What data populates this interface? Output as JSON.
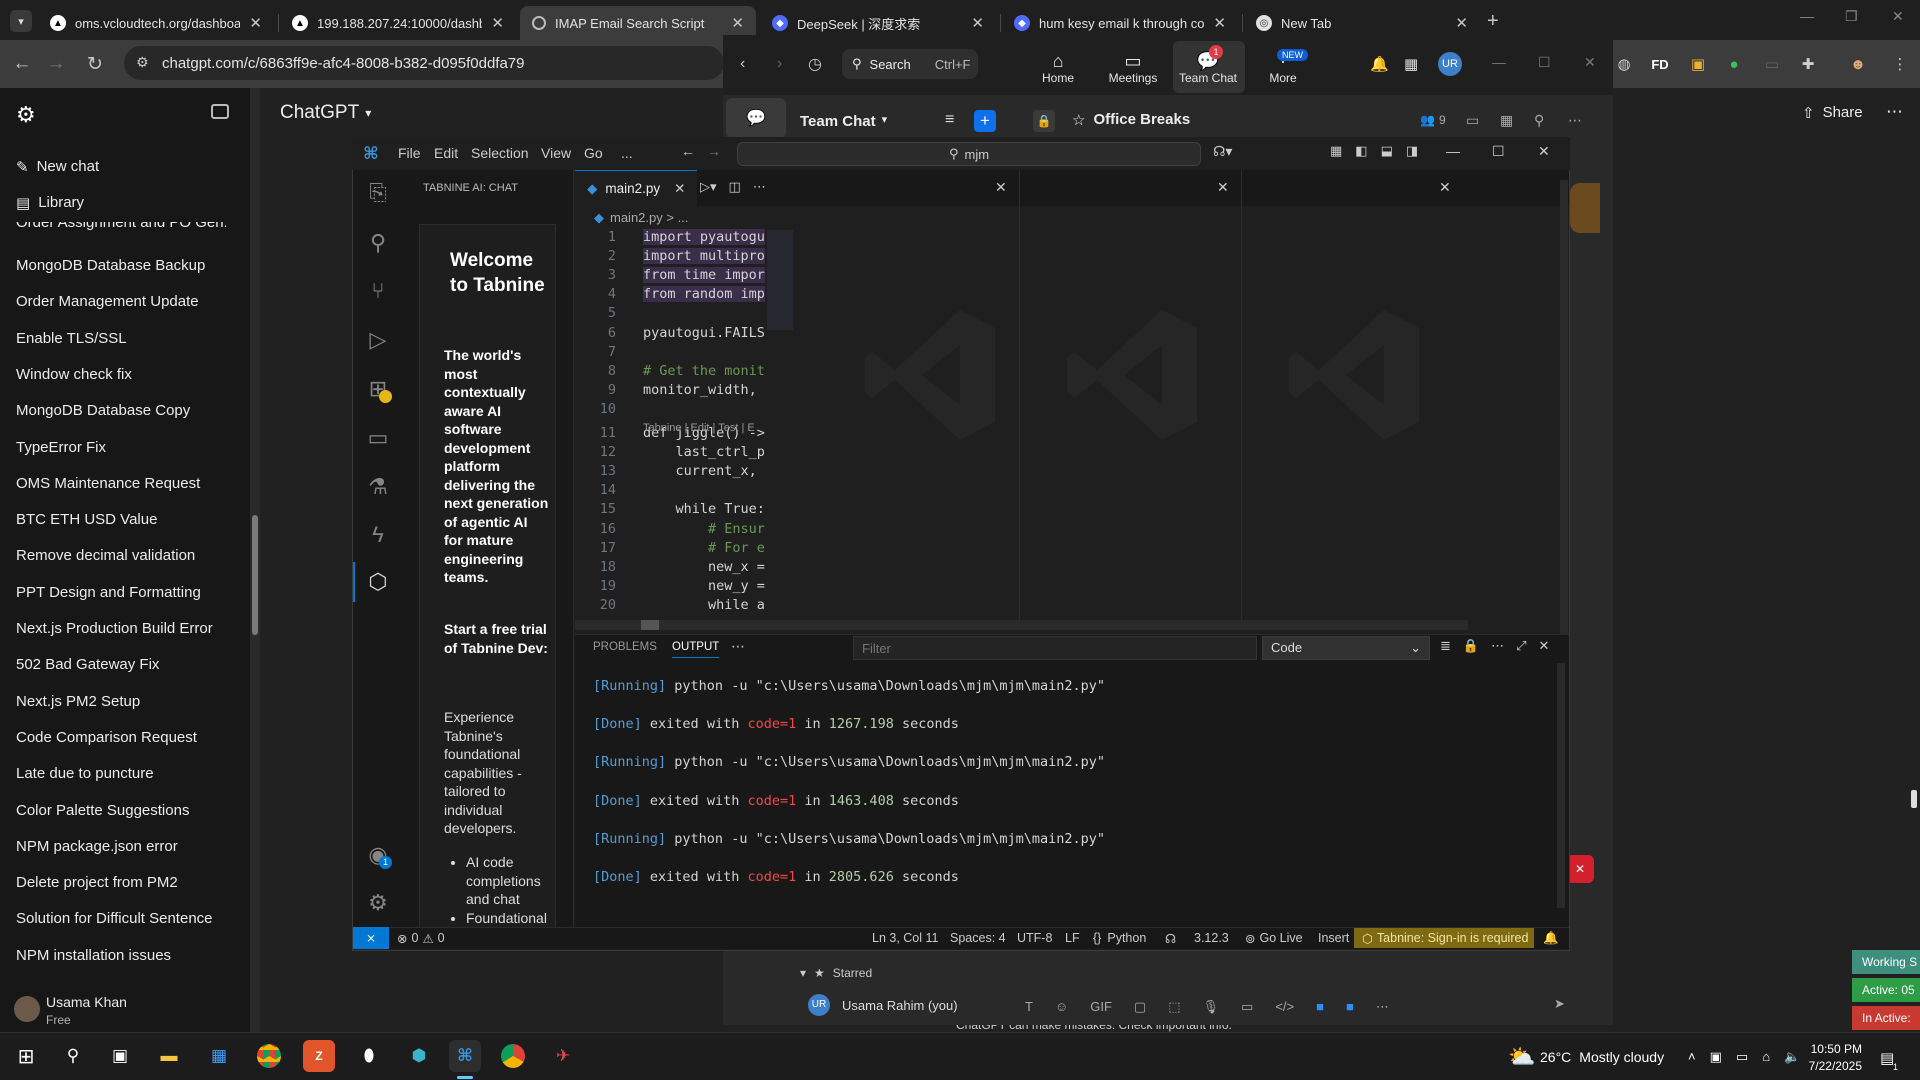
{
  "browser": {
    "tabs": [
      {
        "label": "oms.vcloudtech.org/dashboard",
        "active": false
      },
      {
        "label": "199.188.207.24:10000/dashboa",
        "active": false
      },
      {
        "label": "IMAP Email Search Script",
        "active": true
      },
      {
        "label": "DeepSeek | 深度求索",
        "active": false
      },
      {
        "label": "hum kesy email k through code",
        "active": false
      },
      {
        "label": "New Tab",
        "active": false
      }
    ],
    "url": "chatgpt.com/c/6863ff9e-afc4-8008-b382-d095f0ddfa79"
  },
  "chatgpt": {
    "title": "ChatGPT",
    "share_label": "Share",
    "new_chat": "New chat",
    "library": "Library",
    "partial_item": "Order Assignment and PO Gen...",
    "history": [
      "MongoDB Database Backup",
      "Order Management Update",
      "Enable TLS/SSL",
      "Window check fix",
      "MongoDB Database Copy",
      "TypeError Fix",
      "OMS Maintenance Request",
      "BTC ETH USD Value",
      "Remove decimal validation",
      "PPT Design and Formatting",
      "Next.js Production Build Error",
      "502 Bad Gateway Fix",
      "Next.js PM2 Setup",
      "Code Comparison Request",
      "Late due to puncture",
      "Color Palette Suggestions",
      "NPM package.json error",
      "Delete project from PM2",
      "Solution for Difficult Sentence",
      "NPM installation issues"
    ],
    "user_name": "Usama Khan",
    "user_plan": "Free",
    "footer": "ChatGPT can make mistakes. Check important info."
  },
  "teams": {
    "search_label": "Search",
    "search_shortcut": "Ctrl+F",
    "nav": [
      {
        "label": "Home",
        "icon": "home-icon"
      },
      {
        "label": "Meetings",
        "icon": "video-icon"
      },
      {
        "label": "Team Chat",
        "icon": "chat-icon",
        "badge": "1"
      },
      {
        "label": "More",
        "icon": "more-icon",
        "badge": "NEW"
      }
    ],
    "avatar": "UR",
    "section": "Team Chat",
    "channel": "Office Breaks",
    "members": "9",
    "starred": "Starred",
    "starred_user": "Usama Rahim (you)",
    "gif_label": "GIF"
  },
  "vscode": {
    "menus": [
      "File",
      "Edit",
      "Selection",
      "View",
      "Go",
      "..."
    ],
    "search_value": "mjm",
    "side_title": "TABNINE AI: CHAT",
    "tabnine": {
      "welcome": "Welcome to Tabnine",
      "desc": "The world's most contextually aware AI software development platform delivering the next generation of agentic AI for mature engineering teams.",
      "trial": "Start a free trial of Tabnine Dev:",
      "experience": "Experience Tabnine's foundational capabilities - tailored to individual developers.",
      "bullets": [
        "AI code completions and chat",
        "Foundational"
      ]
    },
    "tab_name": "main2.py",
    "breadcrumb": "main2.py > ...",
    "codelens": "Tabnine | Edit | Test | E",
    "code_lines": [
      {
        "n": "1",
        "t": "import pyautogu"
      },
      {
        "n": "2",
        "t": "import multipro"
      },
      {
        "n": "3",
        "t": "from time impor"
      },
      {
        "n": "4",
        "t": "from random imp"
      },
      {
        "n": "5",
        "t": ""
      },
      {
        "n": "6",
        "t": "pyautogui.FAILS"
      },
      {
        "n": "7",
        "t": ""
      },
      {
        "n": "8",
        "t": "# Get the monit"
      },
      {
        "n": "9",
        "t": "monitor_width,"
      },
      {
        "n": "10",
        "t": ""
      },
      {
        "n": "11",
        "t": "def jiggle() ->"
      },
      {
        "n": "12",
        "t": "    last_ctrl_p"
      },
      {
        "n": "13",
        "t": "    current_x,"
      },
      {
        "n": "14",
        "t": ""
      },
      {
        "n": "15",
        "t": "    while True:"
      },
      {
        "n": "16",
        "t": "        # Ensur"
      },
      {
        "n": "17",
        "t": "        # For e"
      },
      {
        "n": "18",
        "t": "        new_x ="
      },
      {
        "n": "19",
        "t": "        new_y ="
      },
      {
        "n": "20",
        "t": "        while a"
      }
    ],
    "panel_tabs": [
      "PROBLEMS",
      "OUTPUT"
    ],
    "filter_placeholder": "Filter",
    "output_channel": "Code",
    "output": [
      {
        "kind": "run",
        "tag": "[Running]",
        "text": "python -u \"c:\\Users\\usama\\Downloads\\mjm\\mjm\\main2.py\""
      },
      {
        "kind": "done",
        "tag": "[Done]",
        "pre": "exited with",
        "code": "code=1",
        "in": "in",
        "secs": "1267.198",
        "unit": "seconds"
      },
      {
        "kind": "run",
        "tag": "[Running]",
        "text": "python -u \"c:\\Users\\usama\\Downloads\\mjm\\mjm\\main2.py\""
      },
      {
        "kind": "done",
        "tag": "[Done]",
        "pre": "exited with",
        "code": "code=1",
        "in": "in",
        "secs": "1463.408",
        "unit": "seconds"
      },
      {
        "kind": "run",
        "tag": "[Running]",
        "text": "python -u \"c:\\Users\\usama\\Downloads\\mjm\\mjm\\main2.py\""
      },
      {
        "kind": "done",
        "tag": "[Done]",
        "pre": "exited with",
        "code": "code=1",
        "in": "in",
        "secs": "2805.626",
        "unit": "seconds"
      }
    ],
    "status": {
      "errors": "0",
      "warnings": "0",
      "position": "Ln 3, Col 11",
      "spaces": "Spaces: 4",
      "encoding": "UTF-8",
      "eol": "LF",
      "language": "Python",
      "version": "3.12.3",
      "golive": "Go Live",
      "mode": "Insert",
      "tabnine": "Tabnine: Sign-in is required"
    }
  },
  "side_widgets": [
    "Working S",
    "Active: 05",
    "In Active:"
  ],
  "taskbar": {
    "temp": "26°C",
    "weather": "Mostly cloudy",
    "time": "10:50 PM",
    "date": "7/22/2025",
    "notif": "1"
  },
  "colors": {
    "vscode_blue": "#0078d4",
    "status_tabnine": "#7d6a12",
    "keyword": "#569cd6",
    "done_red": "#f44747",
    "number_green": "#b5cea8"
  }
}
